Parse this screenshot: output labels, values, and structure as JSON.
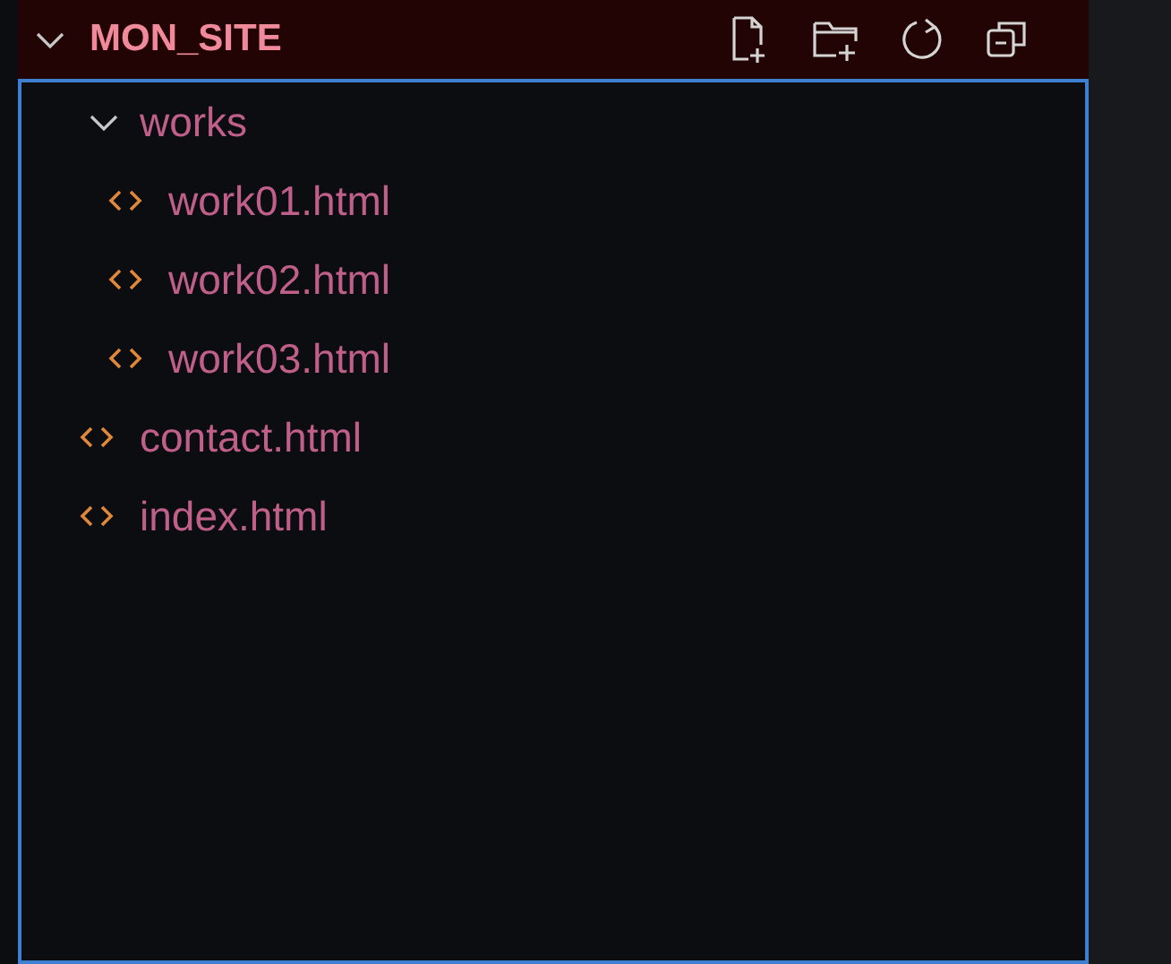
{
  "explorer": {
    "title": "MON_SITE",
    "expanded": true
  },
  "tree": [
    {
      "kind": "folder",
      "name": "works",
      "expanded": true,
      "children": [
        {
          "kind": "file",
          "name": "work01.html"
        },
        {
          "kind": "file",
          "name": "work02.html"
        },
        {
          "kind": "file",
          "name": "work03.html"
        }
      ]
    },
    {
      "kind": "file",
      "name": "contact.html"
    },
    {
      "kind": "file",
      "name": "index.html"
    }
  ]
}
